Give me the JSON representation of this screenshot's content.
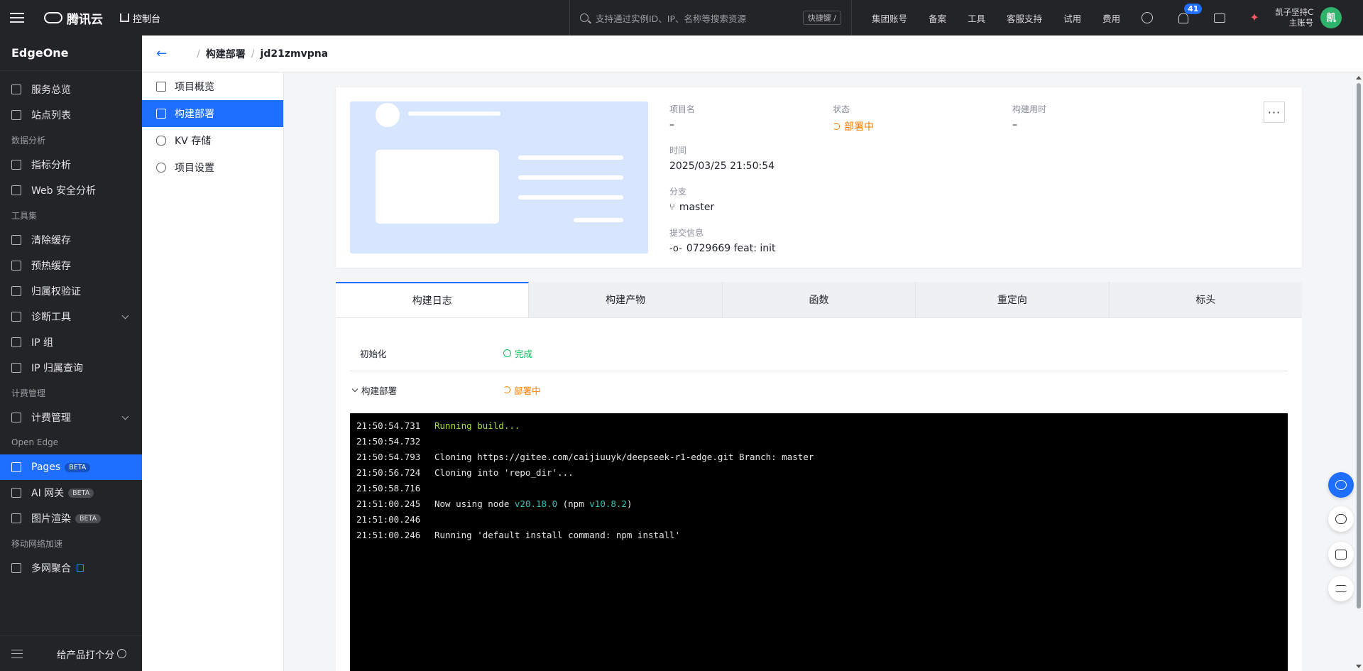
{
  "topbar": {
    "brand": "腾讯云",
    "console_label": "控制台",
    "search_placeholder": "支持通过实例ID、IP、名称等搜索资源",
    "shortcut_label": "快捷键 /",
    "nav": [
      "集团账号",
      "备案",
      "工具",
      "客服支持",
      "试用",
      "费用"
    ],
    "notification_count": "41",
    "user_name": "凯子坚持C",
    "user_role": "主账号",
    "avatar_text": "凯"
  },
  "sidebar": {
    "product": "EdgeOne",
    "items": [
      {
        "type": "item",
        "label": "服务总览",
        "icon": "dashboard-icon"
      },
      {
        "type": "item",
        "label": "站点列表",
        "icon": "list-icon"
      },
      {
        "type": "group",
        "label": "数据分析"
      },
      {
        "type": "item",
        "label": "指标分析",
        "icon": "chart-icon"
      },
      {
        "type": "item",
        "label": "Web 安全分析",
        "icon": "shield-icon"
      },
      {
        "type": "group",
        "label": "工具集"
      },
      {
        "type": "item",
        "label": "清除缓存",
        "icon": "purge-icon"
      },
      {
        "type": "item",
        "label": "预热缓存",
        "icon": "prefetch-icon"
      },
      {
        "type": "item",
        "label": "归属权验证",
        "icon": "verify-icon"
      },
      {
        "type": "item",
        "label": "诊断工具",
        "icon": "diagnose-icon",
        "expandable": true
      },
      {
        "type": "item",
        "label": "IP 组",
        "icon": "ip-group-icon"
      },
      {
        "type": "item",
        "label": "IP 归属查询",
        "icon": "search-icon"
      },
      {
        "type": "group",
        "label": "计费管理"
      },
      {
        "type": "item",
        "label": "计费管理",
        "icon": "billing-icon",
        "expandable": true
      },
      {
        "type": "group",
        "label": "Open Edge"
      },
      {
        "type": "item",
        "label": "Pages",
        "icon": "pages-icon",
        "badge": "BETA",
        "active": true
      },
      {
        "type": "item",
        "label": "AI 网关",
        "icon": "ai-gateway-icon",
        "badge": "BETA"
      },
      {
        "type": "item",
        "label": "图片渲染",
        "icon": "image-icon",
        "badge": "BETA"
      },
      {
        "type": "group",
        "label": "移动网络加速"
      },
      {
        "type": "item",
        "label": "多网聚合",
        "icon": "network-icon",
        "external": true
      }
    ],
    "feedback_label": "给产品打个分"
  },
  "breadcrumb": {
    "section": "构建部署",
    "project": "jd21zmvpna"
  },
  "subnav": [
    {
      "label": "项目概览",
      "icon": "overview-icon"
    },
    {
      "label": "构建部署",
      "icon": "upload-icon",
      "active": true
    },
    {
      "label": "KV 存储",
      "icon": "database-icon"
    },
    {
      "label": "项目设置",
      "icon": "settings-icon"
    }
  ],
  "deployment": {
    "project_name_label": "项目名",
    "project_name_value": "–",
    "status_label": "状态",
    "status_value": "部署中",
    "build_time_label": "构建用时",
    "build_time_value": "–",
    "time_label": "时间",
    "time_value": "2025/03/25 21:50:54",
    "branch_label": "分支",
    "branch_value": "master",
    "commit_label": "提交信息",
    "commit_value": "0729669 feat: init",
    "more_label": "···"
  },
  "tabs": [
    "构建日志",
    "构建产物",
    "函数",
    "重定向",
    "标头"
  ],
  "steps": [
    {
      "name": "初始化",
      "status": "完成"
    },
    {
      "name": "构建部署",
      "status": "部署中"
    }
  ],
  "log": [
    {
      "ts": "21:50:54.731",
      "msg": "Running build..."
    },
    {
      "ts": "21:50:54.732",
      "msg": ""
    },
    {
      "ts": "21:50:54.793",
      "msg": "Cloning https://gitee.com/caijiuuyk/deepseek-r1-edge.git Branch: master"
    },
    {
      "ts": "21:50:56.724",
      "msg": "Cloning into 'repo_dir'..."
    },
    {
      "ts": "21:50:58.716",
      "msg": ""
    },
    {
      "ts": "21:51:00.245",
      "msg_pre": "Now using node ",
      "node": "v20.18.0",
      "msg_mid": " (npm ",
      "npm": "v10.8.2",
      "msg_post": ")"
    },
    {
      "ts": "21:51:00.246",
      "msg": ""
    },
    {
      "ts": "21:51:00.246",
      "msg": "Running 'default install command: npm install'"
    }
  ]
}
